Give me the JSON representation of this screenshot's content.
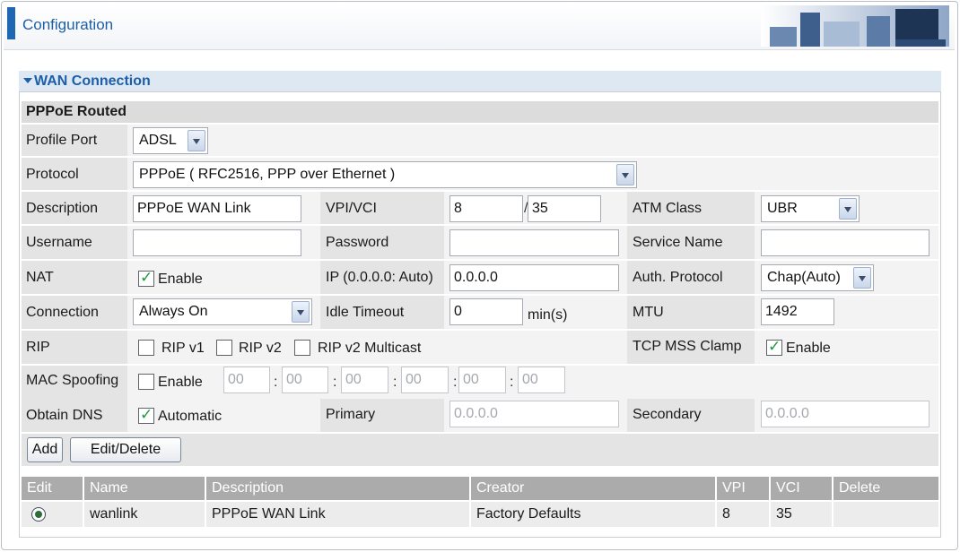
{
  "header": {
    "title": "Configuration",
    "image_icon": "office-photo"
  },
  "section": {
    "title": "WAN Connection",
    "collapse_icon": "triangle-down"
  },
  "group_title": "PPPoE Routed",
  "form": {
    "profile_port": {
      "label": "Profile Port",
      "value": "ADSL"
    },
    "protocol": {
      "label": "Protocol",
      "value": "PPPoE ( RFC2516, PPP over Ethernet )"
    },
    "description": {
      "label": "Description",
      "value": "PPPoE WAN Link"
    },
    "vpi_vci": {
      "label": "VPI/VCI",
      "vpi": "8",
      "vci": "35",
      "separator": "/"
    },
    "atm_class": {
      "label": "ATM Class",
      "value": "UBR"
    },
    "username": {
      "label": "Username",
      "value": ""
    },
    "password": {
      "label": "Password",
      "value": ""
    },
    "service_name": {
      "label": "Service Name",
      "value": ""
    },
    "nat": {
      "label": "NAT",
      "option": "Enable",
      "checked": true
    },
    "ip": {
      "label": "IP (0.0.0.0: Auto)",
      "value": "0.0.0.0"
    },
    "auth_protocol": {
      "label": "Auth. Protocol",
      "value": "Chap(Auto)"
    },
    "connection": {
      "label": "Connection",
      "value": "Always On"
    },
    "idle_timeout": {
      "label": "Idle Timeout",
      "value": "0",
      "unit": "min(s)"
    },
    "mtu": {
      "label": "MTU",
      "value": "1492"
    },
    "rip": {
      "label": "RIP",
      "options": [
        {
          "label": "RIP v1",
          "checked": false
        },
        {
          "label": "RIP v2",
          "checked": false
        },
        {
          "label": "RIP v2 Multicast",
          "checked": false
        }
      ]
    },
    "tcp_mss_clamp": {
      "label": "TCP MSS Clamp",
      "option": "Enable",
      "checked": true
    },
    "mac_spoofing": {
      "label": "MAC Spoofing",
      "option": "Enable",
      "checked": false,
      "octets": [
        "00",
        "00",
        "00",
        "00",
        "00",
        "00"
      ],
      "separator": ":"
    },
    "obtain_dns": {
      "label": "Obtain DNS",
      "option": "Automatic",
      "checked": true
    },
    "primary": {
      "label": "Primary",
      "value": "0.0.0.0"
    },
    "secondary": {
      "label": "Secondary",
      "value": "0.0.0.0"
    }
  },
  "buttons": {
    "add": "Add",
    "edit_delete": "Edit/Delete"
  },
  "table": {
    "headers": [
      "Edit",
      "Name",
      "Description",
      "Creator",
      "VPI",
      "VCI",
      "Delete"
    ],
    "rows": [
      {
        "selected": true,
        "name": "wanlink",
        "description": "PPPoE WAN Link",
        "creator": "Factory Defaults",
        "vpi": "8",
        "vci": "35",
        "delete": ""
      }
    ]
  },
  "colors": {
    "accent": "#1d5ea8",
    "header_bar": "#1f67b3",
    "check": "#1b9a3a"
  }
}
